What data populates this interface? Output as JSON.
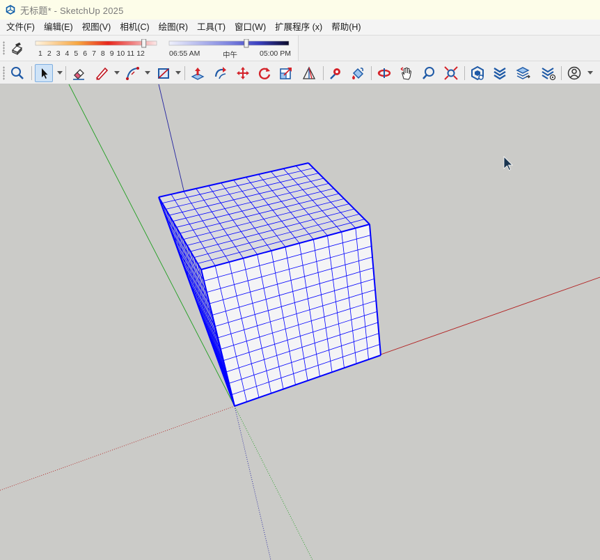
{
  "window": {
    "title": "无标题* - SketchUp 2025",
    "app_icon": "sketchup-logo-icon"
  },
  "menu": {
    "items": [
      "文件(F)",
      "编辑(E)",
      "视图(V)",
      "相机(C)",
      "绘图(R)",
      "工具(T)",
      "窗口(W)",
      "扩展程序 (x)",
      "帮助(H)"
    ]
  },
  "shadows": {
    "month_labels": [
      "1",
      "2",
      "3",
      "4",
      "5",
      "6",
      "7",
      "8",
      "9",
      "10",
      "11",
      "12"
    ],
    "time_start": "06:55 AM",
    "time_noon": "中午",
    "time_end": "05:00 PM",
    "month_value": 11,
    "time_value_fraction": 0.65
  },
  "toolbar": {
    "tools": [
      "zoom-extents-icon",
      "select-icon",
      "eraser-icon",
      "pencil-line-icon",
      "arc-icon",
      "rectangle-icon",
      "push-pull-icon",
      "follow-me-icon",
      "move-icon",
      "rotate-icon",
      "scale-icon",
      "protractor-icon",
      "paint-bucket-icon",
      "orbit-icon",
      "pan-icon",
      "hand-icon",
      "zoom-icon",
      "zoom-window-icon",
      "warehouse-icon",
      "extension-warehouse-icon",
      "layers-icon",
      "extension-manager-icon",
      "account-icon"
    ]
  },
  "colors": {
    "selection": "#0000ff",
    "axis_red": "#b22222",
    "axis_green": "#1e9e1e",
    "axis_blue": "#2020a0",
    "viewport_bg": "#cbcbc8"
  }
}
